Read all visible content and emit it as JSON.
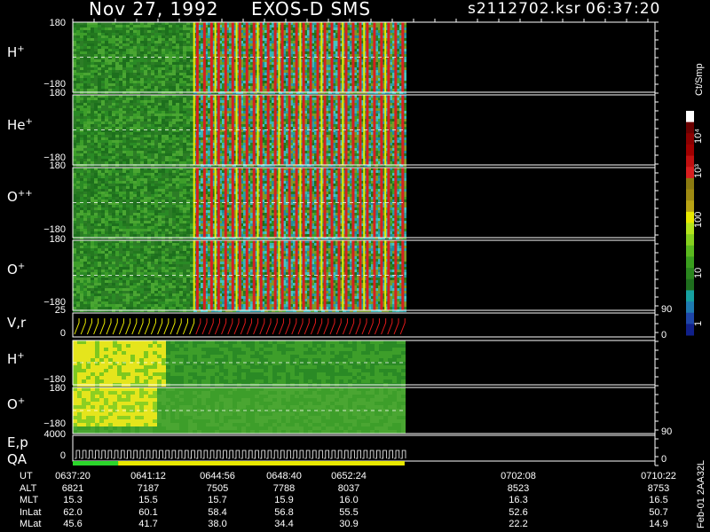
{
  "header": {
    "date": "Nov 27, 1992",
    "instrument": "EXOS-D SMS",
    "file": "s2112702.ksr",
    "time": "06:37:20"
  },
  "colors": {
    "background": "#000000",
    "low": "#1e7a1e",
    "mid": "#3fbfbf",
    "high": "#d81f1f",
    "peak": "#e8e800",
    "trace_before": "#e8e800",
    "trace_after": "#e01a1a"
  },
  "panels": [
    {
      "id": "h-plus",
      "label_main": "H",
      "label_sup": "+",
      "y_top": "180",
      "y_bottom": "−180"
    },
    {
      "id": "he-plus",
      "label_main": "He",
      "label_sup": "+",
      "y_top": "180",
      "y_bottom": "−180"
    },
    {
      "id": "o-plusplus",
      "label_main": "O",
      "label_sup": "++",
      "y_top": "180",
      "y_bottom": "−180"
    },
    {
      "id": "o-plus",
      "label_main": "O",
      "label_sup": "+",
      "y_top": "180",
      "y_bottom": "−180"
    },
    {
      "id": "vr",
      "label_main": "V,r",
      "label_sup": "",
      "y_top": "25",
      "y_bottom": "0",
      "right_top": "90",
      "right_bottom": "0"
    },
    {
      "id": "h-plus-2",
      "label_main": "H",
      "label_sup": "+",
      "y_top": "180",
      "y_bottom": "−180"
    },
    {
      "id": "o-plus-2",
      "label_main": "O",
      "label_sup": "+",
      "y_top": "180",
      "y_bottom": "−180"
    },
    {
      "id": "ep-qa",
      "label_main": "E,p",
      "label_line2": "QA",
      "y_top": "4000",
      "y_bottom": "0",
      "right_top": "90",
      "right_bottom": "0"
    }
  ],
  "colorbar": {
    "unit": "Ct/Smp",
    "ticks": [
      "10⁴",
      "10³",
      "100",
      "10",
      "1"
    ]
  },
  "file_tag": "Feb-01 2AA32L",
  "ephemeris": {
    "rows": [
      {
        "name": "UT",
        "values": [
          "0637:20",
          "0641:12",
          "0644:56",
          "0648:40",
          "0652:24",
          "0702:08",
          "0710:22"
        ]
      },
      {
        "name": "ALT",
        "values": [
          "6821",
          "7187",
          "7505",
          "7788",
          "8037",
          "8523",
          "8753"
        ]
      },
      {
        "name": "MLT",
        "values": [
          "15.3",
          "15.5",
          "15.7",
          "15.9",
          "16.0",
          "16.3",
          "16.5"
        ]
      },
      {
        "name": "InLat",
        "values": [
          "62.0",
          "60.1",
          "58.4",
          "56.8",
          "55.5",
          "52.6",
          "50.7"
        ]
      },
      {
        "name": "MLat",
        "values": [
          "45.6",
          "41.7",
          "38.0",
          "34.4",
          "30.9",
          "22.2",
          "14.9"
        ]
      }
    ]
  },
  "chart_data": {
    "type": "heatmap",
    "title": "Nov 27, 1992   EXOS-D SMS   s2112702.ksr  06:37:20",
    "x_tick_labels": [
      "0637:20",
      "0641:12",
      "0644:56",
      "0648:40",
      "0652:24",
      "0702:08",
      "0710:22"
    ],
    "data_end_fraction": 0.57,
    "spin_onset_fraction": 0.205,
    "spin_periods_count": 30,
    "colorbar_range": [
      1,
      10000
    ],
    "colorbar_scale": "log",
    "series": [
      {
        "name": "H+"
      },
      {
        "name": "He+"
      },
      {
        "name": "O++"
      },
      {
        "name": "O+"
      },
      {
        "name": "V,r"
      },
      {
        "name": "H+"
      },
      {
        "name": "O+"
      },
      {
        "name": "E,p QA"
      }
    ]
  }
}
